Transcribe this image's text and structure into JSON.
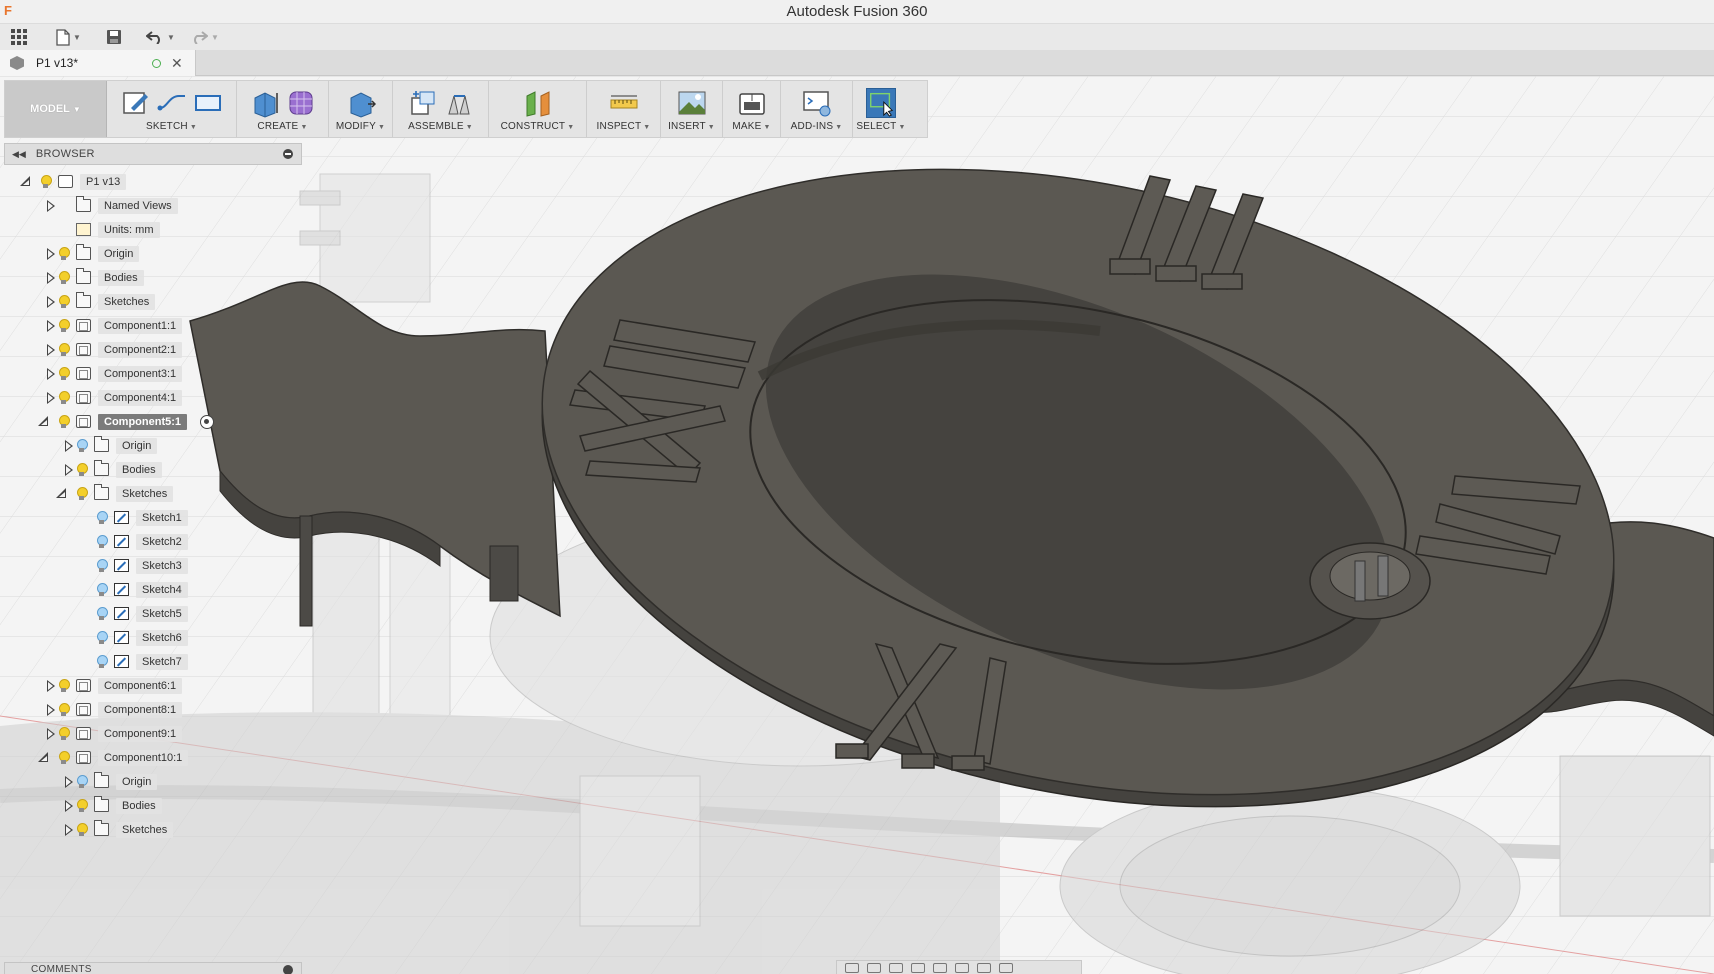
{
  "app": {
    "title": "Autodesk Fusion 360",
    "logo_letter": "F"
  },
  "document_tab": {
    "name": "P1 v13*"
  },
  "toolbar": {
    "workspace": "MODEL",
    "groups": [
      {
        "id": "sketch",
        "label": "SKETCH"
      },
      {
        "id": "create",
        "label": "CREATE"
      },
      {
        "id": "modify",
        "label": "MODIFY"
      },
      {
        "id": "assemble",
        "label": "ASSEMBLE"
      },
      {
        "id": "construct",
        "label": "CONSTRUCT"
      },
      {
        "id": "inspect",
        "label": "INSPECT"
      },
      {
        "id": "insert",
        "label": "INSERT"
      },
      {
        "id": "make",
        "label": "MAKE"
      },
      {
        "id": "addins",
        "label": "ADD-INS"
      },
      {
        "id": "select",
        "label": "SELECT"
      }
    ]
  },
  "browser": {
    "title": "BROWSER",
    "tree": [
      {
        "label": "P1 v13",
        "level": 0,
        "expanded": true,
        "icon": "document-icon",
        "visible": true
      },
      {
        "label": "Named Views",
        "level": 1,
        "expanded": false,
        "icon": "folder-icon",
        "visible": null
      },
      {
        "label": "Units: mm",
        "level": 1,
        "expanded": null,
        "icon": "units-icon",
        "visible": null
      },
      {
        "label": "Origin",
        "level": 1,
        "expanded": false,
        "icon": "folder-icon",
        "visible": true
      },
      {
        "label": "Bodies",
        "level": 1,
        "expanded": false,
        "icon": "folder-icon",
        "visible": true
      },
      {
        "label": "Sketches",
        "level": 1,
        "expanded": false,
        "icon": "folder-icon",
        "visible": true
      },
      {
        "label": "Component1:1",
        "level": 1,
        "expanded": false,
        "icon": "component-icon",
        "visible": true
      },
      {
        "label": "Component2:1",
        "level": 1,
        "expanded": false,
        "icon": "component-icon",
        "visible": true
      },
      {
        "label": "Component3:1",
        "level": 1,
        "expanded": false,
        "icon": "component-icon",
        "visible": true
      },
      {
        "label": "Component4:1",
        "level": 1,
        "expanded": false,
        "icon": "component-icon",
        "visible": true
      },
      {
        "label": "Component5:1",
        "level": 1,
        "expanded": true,
        "icon": "component-icon",
        "visible": true,
        "active": true
      },
      {
        "label": "Origin",
        "level": 2,
        "expanded": false,
        "icon": "folder-icon",
        "visible": true,
        "blue": true
      },
      {
        "label": "Bodies",
        "level": 2,
        "expanded": false,
        "icon": "folder-icon",
        "visible": true
      },
      {
        "label": "Sketches",
        "level": 2,
        "expanded": true,
        "icon": "folder-icon",
        "visible": true
      },
      {
        "label": "Sketch1",
        "level": 3,
        "expanded": null,
        "icon": "sketch-icon",
        "visible": true,
        "blue": true
      },
      {
        "label": "Sketch2",
        "level": 3,
        "expanded": null,
        "icon": "sketch-icon",
        "visible": true,
        "blue": true
      },
      {
        "label": "Sketch3",
        "level": 3,
        "expanded": null,
        "icon": "sketch-icon",
        "visible": true,
        "blue": true
      },
      {
        "label": "Sketch4",
        "level": 3,
        "expanded": null,
        "icon": "sketch-icon",
        "visible": true,
        "blue": true
      },
      {
        "label": "Sketch5",
        "level": 3,
        "expanded": null,
        "icon": "sketch-icon",
        "visible": true,
        "blue": true
      },
      {
        "label": "Sketch6",
        "level": 3,
        "expanded": null,
        "icon": "sketch-icon",
        "visible": true,
        "blue": true
      },
      {
        "label": "Sketch7",
        "level": 3,
        "expanded": null,
        "icon": "sketch-icon",
        "visible": true,
        "blue": true
      },
      {
        "label": "Component6:1",
        "level": 1,
        "expanded": false,
        "icon": "component-icon",
        "visible": true
      },
      {
        "label": "Component8:1",
        "level": 1,
        "expanded": false,
        "icon": "component-icon",
        "visible": true
      },
      {
        "label": "Component9:1",
        "level": 1,
        "expanded": false,
        "icon": "component-icon",
        "visible": true
      },
      {
        "label": "Component10:1",
        "level": 1,
        "expanded": true,
        "icon": "component-icon",
        "visible": true
      },
      {
        "label": "Origin",
        "level": 2,
        "expanded": false,
        "icon": "folder-icon",
        "visible": true,
        "blue": true
      },
      {
        "label": "Bodies",
        "level": 2,
        "expanded": false,
        "icon": "folder-icon",
        "visible": true
      },
      {
        "label": "Sketches",
        "level": 2,
        "expanded": false,
        "icon": "folder-icon",
        "visible": true
      }
    ]
  },
  "comments": {
    "title": "COMMENTS"
  },
  "colors": {
    "model_body": "#5b5852",
    "model_edge": "#2f2d2a",
    "grid": "#d6d6d6",
    "select_active": "#3a78b8",
    "bulb": "#f3cf2b"
  }
}
